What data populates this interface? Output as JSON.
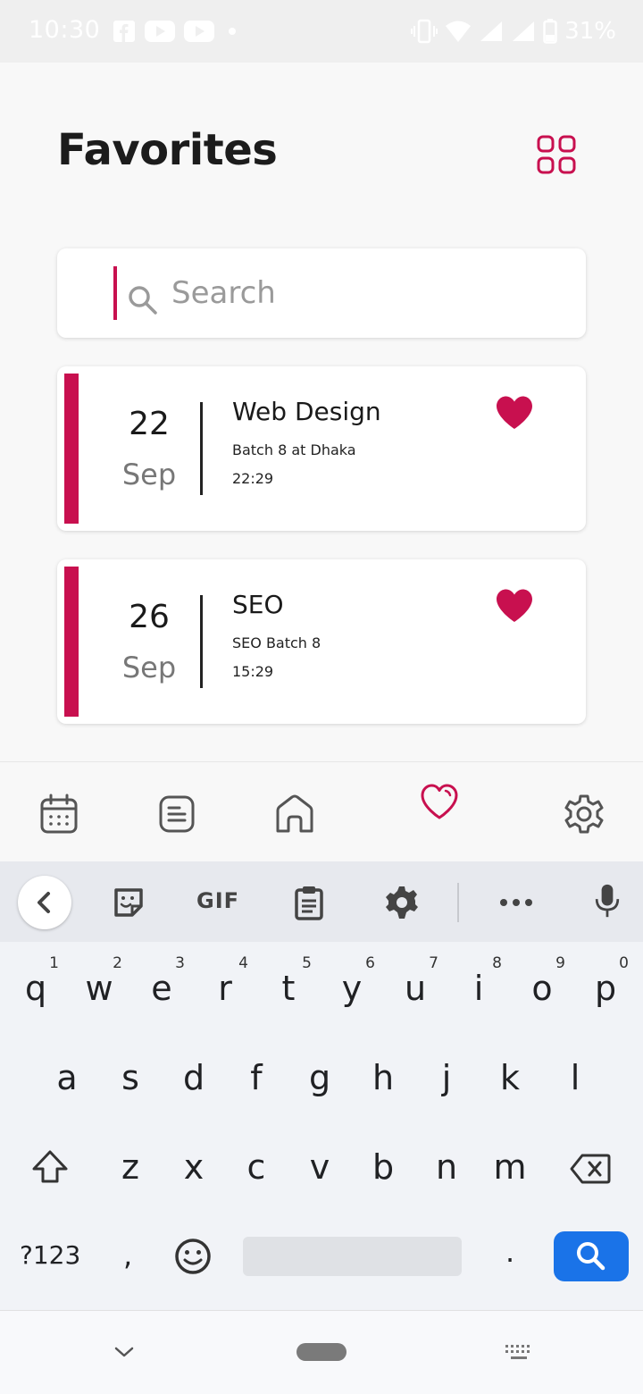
{
  "status_bar": {
    "time": "10:30",
    "battery": "31%"
  },
  "header": {
    "title": "Favorites"
  },
  "search": {
    "placeholder": "Search"
  },
  "cards": [
    {
      "day": "22",
      "month": "Sep",
      "title": "Web Design",
      "subtitle": "Batch 8 at Dhaka",
      "time": "22:29"
    },
    {
      "day": "26",
      "month": "Sep",
      "title": "SEO",
      "subtitle": "SEO Batch 8",
      "time": "15:29"
    }
  ],
  "bottom_nav": [
    "calendar-icon",
    "notes-icon",
    "home-icon",
    "heart-icon",
    "settings-icon"
  ],
  "keyboard": {
    "toolbar_gif": "GIF",
    "row1": [
      {
        "key": "q",
        "hint": "1"
      },
      {
        "key": "w",
        "hint": "2"
      },
      {
        "key": "e",
        "hint": "3"
      },
      {
        "key": "r",
        "hint": "4"
      },
      {
        "key": "t",
        "hint": "5"
      },
      {
        "key": "y",
        "hint": "6"
      },
      {
        "key": "u",
        "hint": "7"
      },
      {
        "key": "i",
        "hint": "8"
      },
      {
        "key": "o",
        "hint": "9"
      },
      {
        "key": "p",
        "hint": "0"
      }
    ],
    "row2": [
      "a",
      "s",
      "d",
      "f",
      "g",
      "h",
      "j",
      "k",
      "l"
    ],
    "row3": [
      "z",
      "x",
      "c",
      "v",
      "b",
      "n",
      "m"
    ],
    "symbols_label": "?123",
    "comma": ",",
    "period": "."
  },
  "colors": {
    "accent": "#c8104f",
    "keyboard_action": "#1a73e8"
  }
}
